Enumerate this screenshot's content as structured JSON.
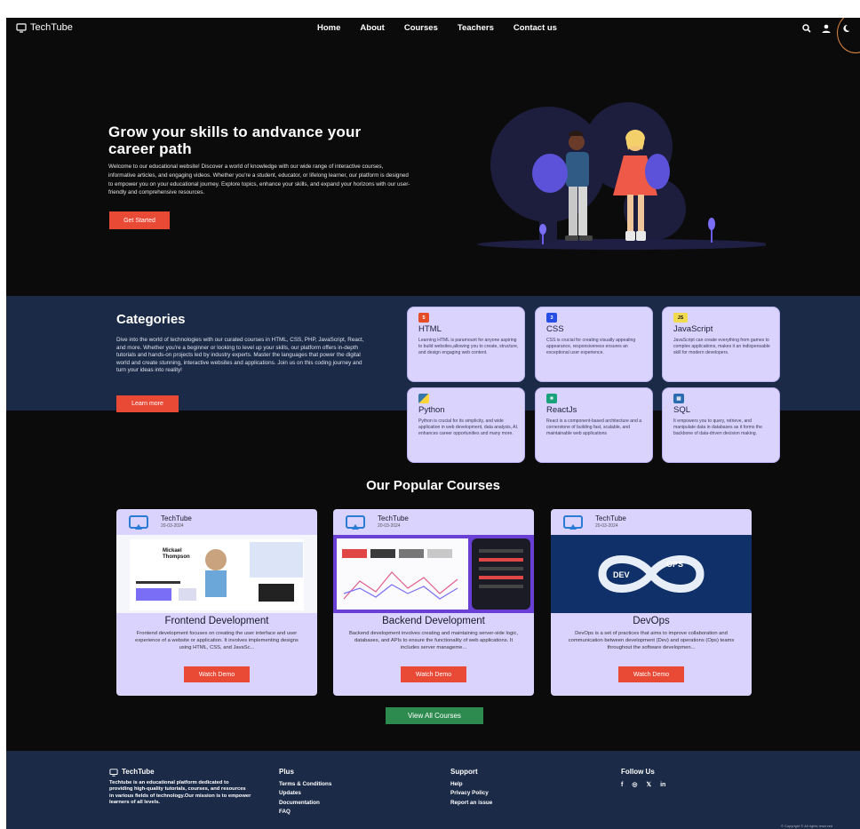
{
  "nav": {
    "brand": "TechTube",
    "links": [
      "Home",
      "About",
      "Courses",
      "Teachers",
      "Contact us"
    ]
  },
  "hero": {
    "title": "Grow your skills to andvance your career path",
    "text": "Welcome to our educational website! Discover a world of knowledge with our wide range of interactive courses, informative articles, and engaging videos. Whether you're a student, educator, or lifelong learner, our platform is designed to empower you on your educational journey. Explore topics, enhance your skills, and expand your horizons with our user-friendly and comprehensive resources.",
    "button": "Get Started"
  },
  "categories": {
    "title": "Categories",
    "text": "Dive into the world of technologies with our curated courses in HTML, CSS, PHP, JavaScript, React, and more. Whether you're a beginner or looking to level up your skills, our platform offers in-depth tutorials and hands-on projects led by industry experts. Master the languages that power the digital world and create stunning, interactive websites and applications. Join us on this coding journey and turn your ideas into reality!",
    "button": "Learn more",
    "tiles": [
      {
        "title": "HTML",
        "desc": "Learning HTML is paramount for anyone aspiring to build websites,allowing you to create, structure, and design engaging web content.",
        "icon": "html5-icon",
        "color": "#e44d26"
      },
      {
        "title": "CSS",
        "desc": "CSS is crucial for creating visually appealing appearance, responsiveness ensures an exceptional user experience.",
        "icon": "css3-icon",
        "color": "#264de4"
      },
      {
        "title": "JavaScript",
        "desc": "JavaScript can create everything from games to complex applications, makes it an indispensable skill for modern developers.",
        "icon": "js-icon",
        "color": "#f0db4f"
      },
      {
        "title": "Python",
        "desc": "Python is crucial for its simplicity, and wide application in web development, data analysis, AI. enhances career opportunities and many more.",
        "icon": "python-icon",
        "color": "#3776ab"
      },
      {
        "title": "ReactJs",
        "desc": "React is a component-based architecture and a cornerstone of building fast, scalable, and maintainable web applications",
        "icon": "react-icon",
        "color": "#1aa37a"
      },
      {
        "title": "SQL",
        "desc": "It empowers you to query, retrieve, and manipulate data in databases as it forms the backbone of data-driven decision making.",
        "icon": "database-icon",
        "color": "#2b6cb0"
      }
    ]
  },
  "popular": {
    "title": "Our Popular Courses",
    "courses": [
      {
        "channel": "TechTube",
        "date": "20-03-2024",
        "title": "Frontend Development",
        "desc": "Frontend development focuses on creating the user interface and user experience of a website or application. It involves implementing designs using HTML, CSS, and JavaSc...",
        "button": "Watch Demo",
        "thumb_name": "Mickael Thompson"
      },
      {
        "channel": "TechTube",
        "date": "20-03-2024",
        "title": "Backend Development",
        "desc": "Backend development involves creating and maintaining server-side logic, databases, and APIs to ensure the functionality of web applications. It includes server manageme...",
        "button": "Watch Demo"
      },
      {
        "channel": "TechTube",
        "date": "20-03-2024",
        "title": "DevOps",
        "desc": "DevOps is a set of practices that aims to improve collaboration and communication between development (Dev) and operations (Ops) teams throughout the software developmen...",
        "button": "Watch Demo",
        "thumb_dev": "DEV",
        "thumb_ops": "OPS"
      }
    ],
    "view_all": "View All Courses"
  },
  "footer": {
    "brand": "TechTube",
    "about": "Techtube is an educational platform dedicated to providing high-quality tutorials, courses, and resources in various fields of technology.Our mission is to empower learners of all levels.",
    "plus": {
      "title": "Plus",
      "links": [
        "Terms & Conditions",
        "Updates",
        "Documentation",
        "FAQ"
      ]
    },
    "support": {
      "title": "Support",
      "links": [
        "Help",
        "Privacy Policy",
        "Report an issue"
      ]
    },
    "follow": {
      "title": "Follow Us",
      "socials": [
        "f",
        "◎",
        "𝕏",
        "in"
      ]
    },
    "copyright": "© Copyright © All rights reserved"
  }
}
